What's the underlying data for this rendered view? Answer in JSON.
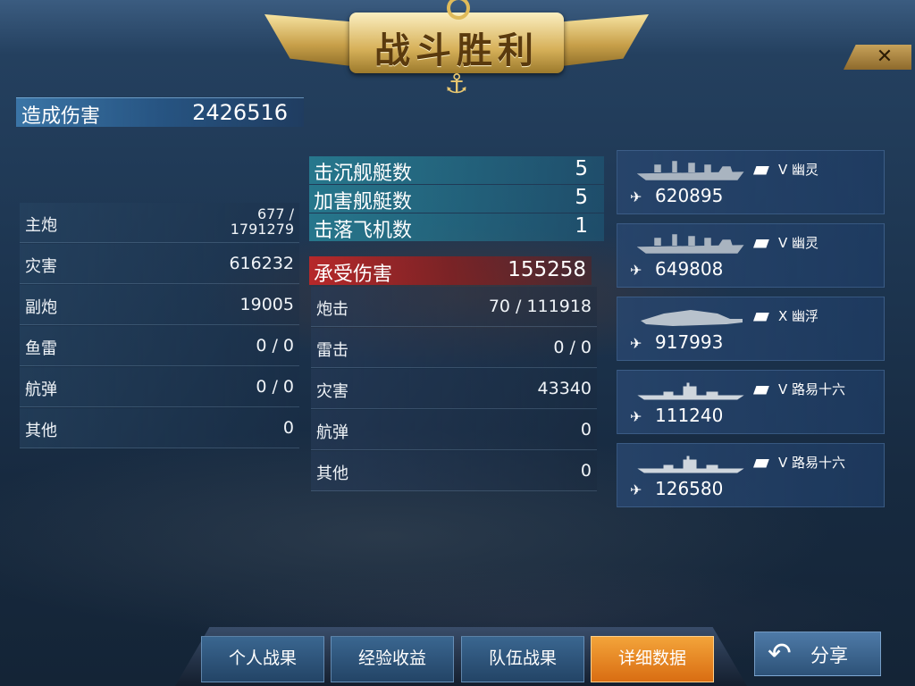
{
  "banner": {
    "title": "战斗胜利"
  },
  "close": {
    "symbol": "✕"
  },
  "total_damage": {
    "label": "造成伤害",
    "value": "2426516"
  },
  "damage_breakdown": [
    {
      "label": "主炮",
      "value_line1": "677 /",
      "value_line2": "1791279"
    },
    {
      "label": "灾害",
      "value": "616232"
    },
    {
      "label": "副炮",
      "value": "19005"
    },
    {
      "label": "鱼雷",
      "value": "0 / 0"
    },
    {
      "label": "航弹",
      "value": "0 / 0"
    },
    {
      "label": "其他",
      "value": "0"
    }
  ],
  "battle_stats": [
    {
      "label": "击沉舰艇数",
      "value": "5"
    },
    {
      "label": "加害舰艇数",
      "value": "5"
    },
    {
      "label": "击落飞机数",
      "value": "1"
    }
  ],
  "damage_received": {
    "label": "承受伤害",
    "value": "155258"
  },
  "received_breakdown": [
    {
      "label": "炮击",
      "value": "70 / 111918"
    },
    {
      "label": "雷击",
      "value": "0 / 0"
    },
    {
      "label": "灾害",
      "value": "43340"
    },
    {
      "label": "航弹",
      "value": "0"
    },
    {
      "label": "其他",
      "value": "0"
    }
  ],
  "ships": [
    {
      "tag": "V 幽灵",
      "damage": "620895",
      "silhouette": "battleship-silhouette"
    },
    {
      "tag": "V 幽灵",
      "damage": "649808",
      "silhouette": "battleship-silhouette"
    },
    {
      "tag": "X 幽浮",
      "damage": "917993",
      "silhouette": "saucer-silhouette"
    },
    {
      "tag": "V 路易十六",
      "damage": "111240",
      "silhouette": "destroyer-silhouette"
    },
    {
      "tag": "V 路易十六",
      "damage": "126580",
      "silhouette": "destroyer-silhouette"
    }
  ],
  "tabs": [
    {
      "label": "个人战果",
      "active": false
    },
    {
      "label": "经验收益",
      "active": false
    },
    {
      "label": "队伍战果",
      "active": false
    },
    {
      "label": "详细数据",
      "active": true
    }
  ],
  "share": {
    "label": "分享",
    "icon": "share-arrow-icon"
  },
  "colors": {
    "accent_orange": "#e8881f",
    "received_red": "#b82a2a",
    "stats_teal": "#28828f"
  }
}
